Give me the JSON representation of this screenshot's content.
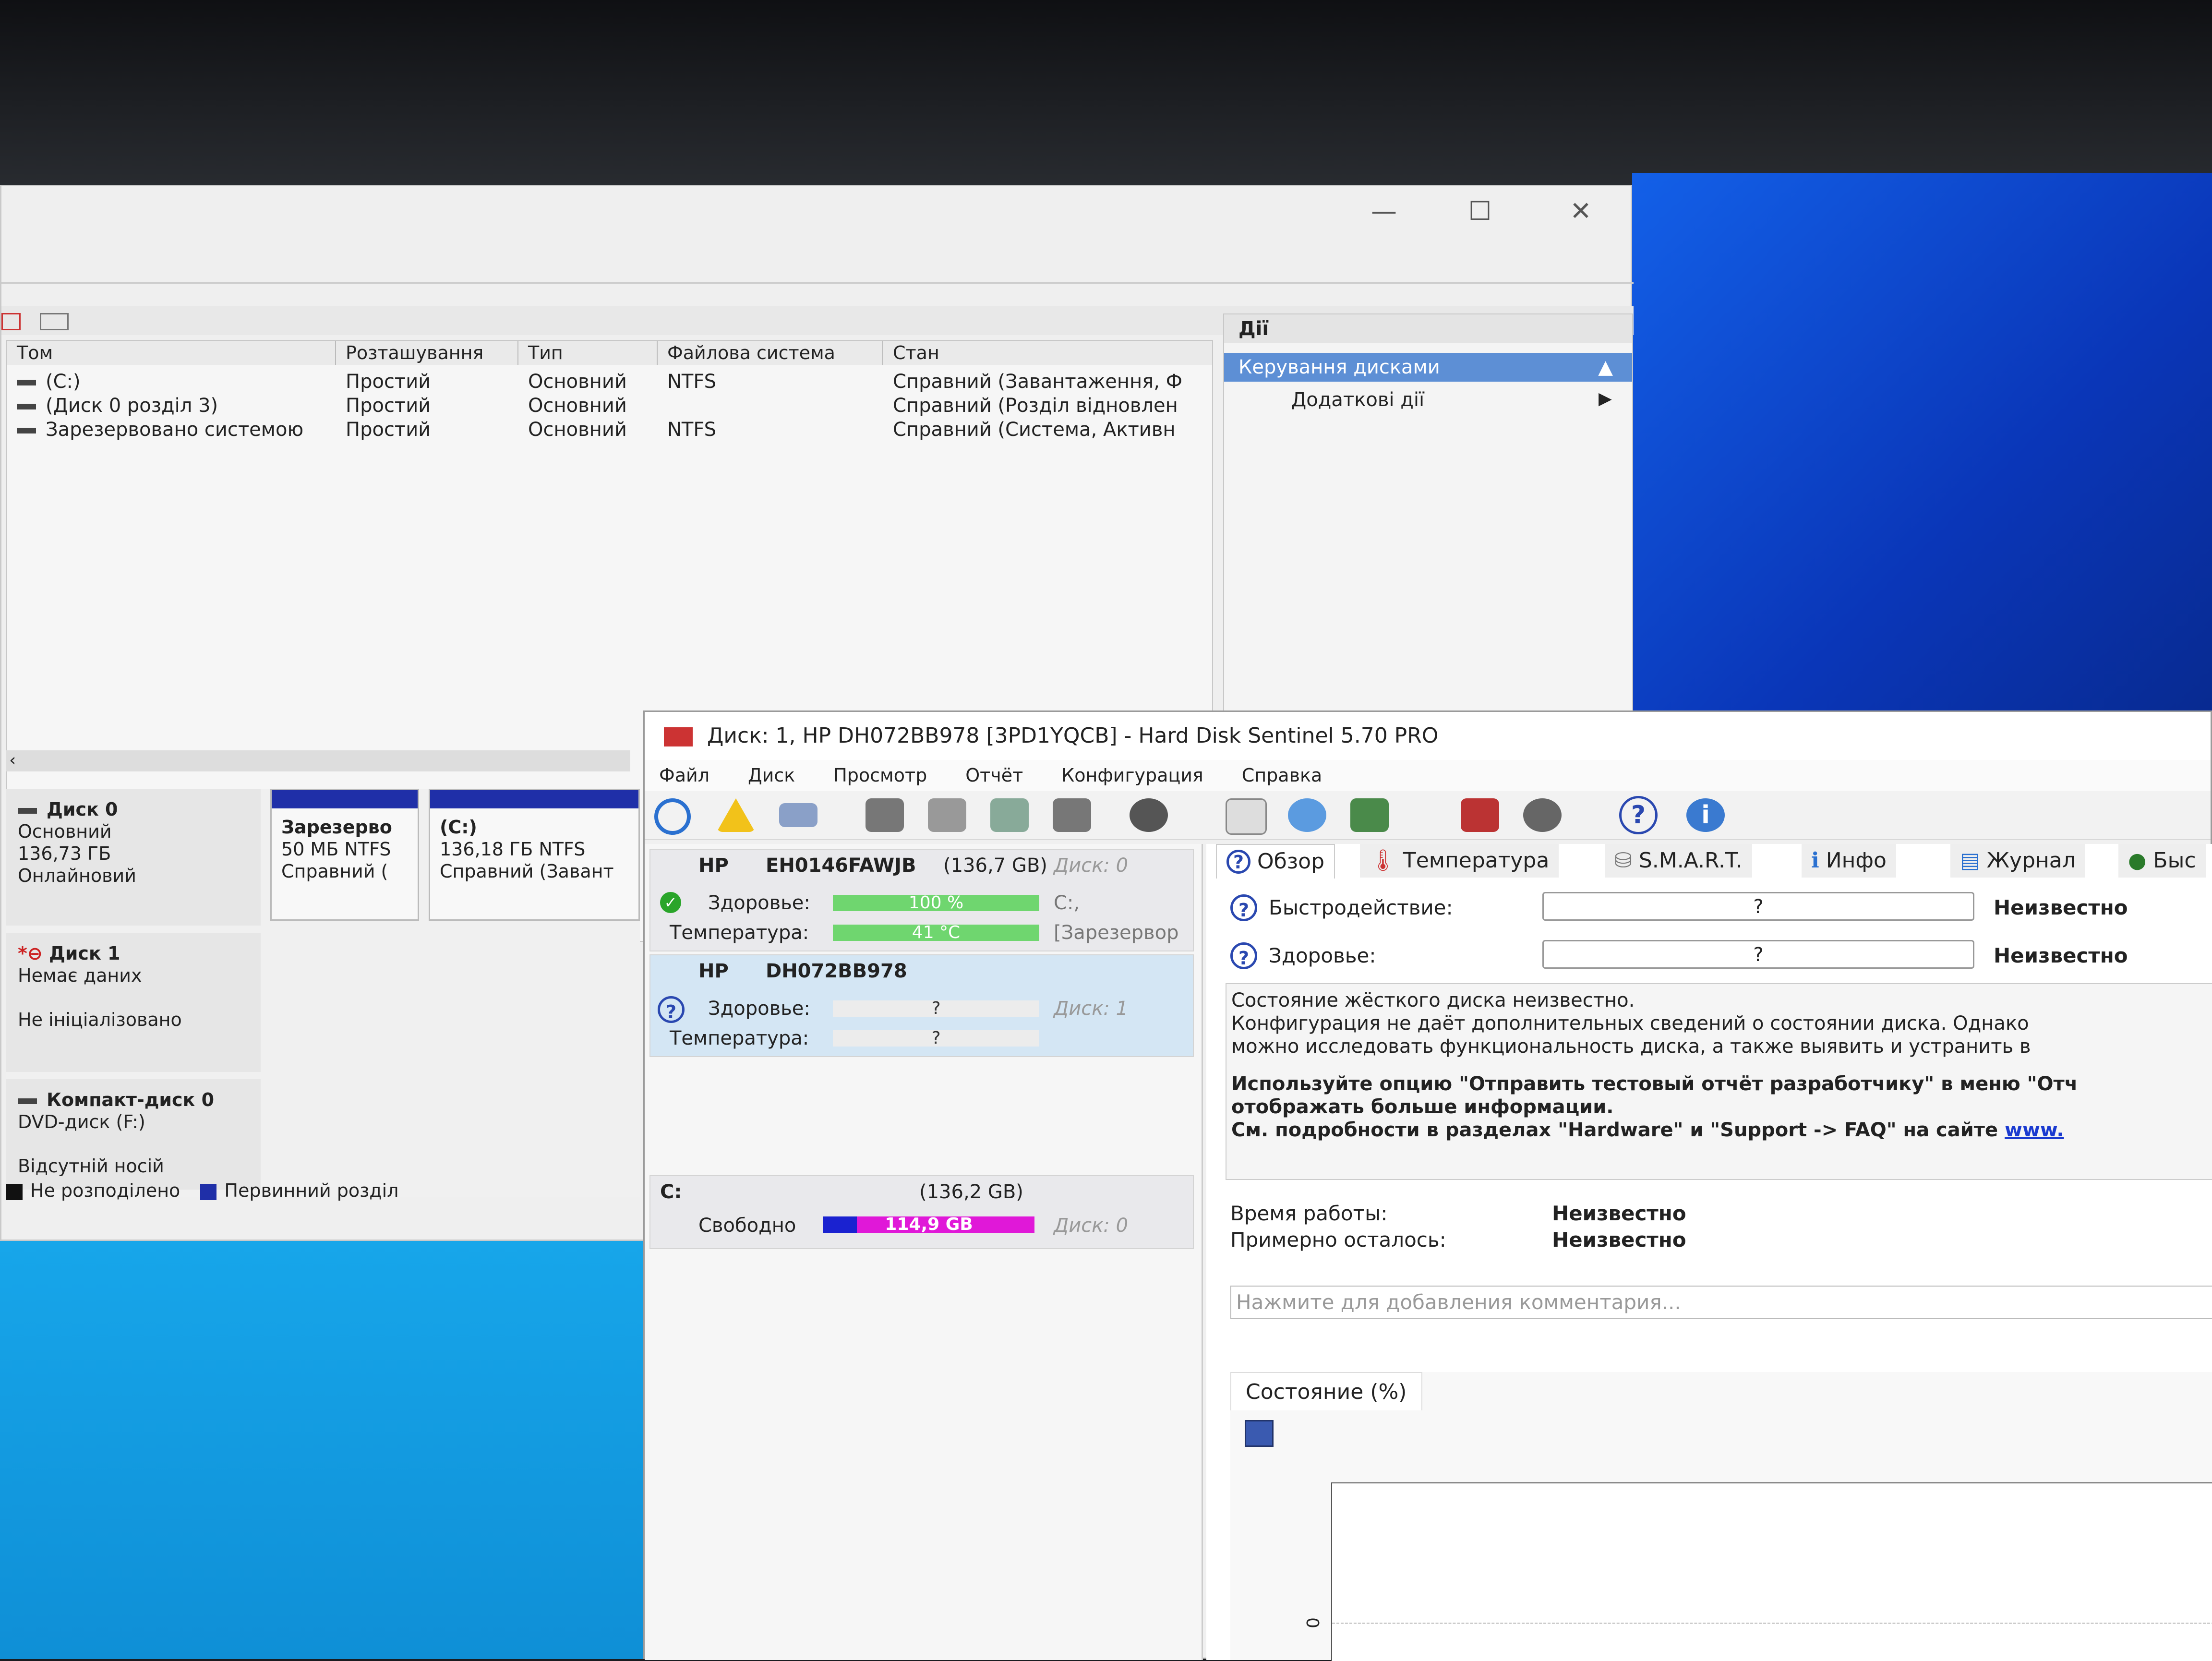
{
  "disk_management": {
    "columns": [
      "Том",
      "Розташування",
      "Тип",
      "Файлова система",
      "Стан"
    ],
    "volumes": [
      {
        "name": "(C:)",
        "layout": "Простий",
        "type": "Основний",
        "fs": "NTFS",
        "status": "Справний (Завантаження, Ф"
      },
      {
        "name": "(Диск 0 розділ 3)",
        "layout": "Простий",
        "type": "Основний",
        "fs": "",
        "status": "Справний (Розділ відновлен"
      },
      {
        "name": "Зарезервовано системою",
        "layout": "Простий",
        "type": "Основний",
        "fs": "NTFS",
        "status": "Справний (Система, Активн"
      }
    ],
    "actions": {
      "header": "Дії",
      "selected": "Керування дисками",
      "sub": "Додаткові дії"
    },
    "disks": [
      {
        "name": "Диск 0",
        "line1": "Основний",
        "line2": "136,73 ГБ",
        "line3": "Онлайновий"
      },
      {
        "name": "Диск 1",
        "line1": "Немає даних",
        "line2": "",
        "line3": "Не ініціалізовано"
      },
      {
        "name": "Компакт-диск 0",
        "line1": "DVD-диск (F:)",
        "line2": "",
        "line3": "Відсутній носій"
      }
    ],
    "partitions": [
      {
        "title": "Зарезерво",
        "size": "50 МБ NTFS",
        "status": "Справний ("
      },
      {
        "title": "(C:)",
        "size": "136,18 ГБ NTFS",
        "status": "Справний (Завант"
      }
    ],
    "legend": {
      "unallocated": "Не розподілено",
      "primary": "Первинний розділ"
    }
  },
  "hds": {
    "title": "Диск: 1, HP      DH072BB978 [3PD1YQCB]  -  Hard Disk Sentinel 5.70 PRO",
    "menu": [
      "Файл",
      "Диск",
      "Просмотр",
      "Отчёт",
      "Конфигурация",
      "Справка"
    ],
    "disk0": {
      "vendor": "HP",
      "model": "EH0146FAWJB",
      "size": "(136,7 GB)",
      "disk_label": "Диск: 0",
      "health_label": "Здоровье:",
      "health_value": "100 %",
      "health_pct": 100,
      "temp_label": "Температура:",
      "temp_value": "41 °C",
      "vol1": "C:,",
      "vol2": "[Зарезервор"
    },
    "disk1": {
      "vendor": "HP",
      "model": "DH072BB978",
      "health_label": "Здоровье:",
      "health_value": "?",
      "disk_label": "Диск: 1",
      "temp_label": "Температура:",
      "temp_value": "?"
    },
    "volume": {
      "letter": "C:",
      "size": "(136,2 GB)",
      "free_label": "Свободно",
      "free_value": "114,9 GB",
      "disk_label": "Диск: 0",
      "free_pct": 84
    },
    "tabs": [
      "Обзор",
      "Температура",
      "S.M.A.R.T.",
      "Инфо",
      "Журнал",
      "Быс"
    ],
    "perf_label": "Быстродействие:",
    "perf_value": "?",
    "perf_status": "Неизвестно",
    "health_label": "Здоровье:",
    "health_value": "?",
    "health_status": "Неизвестно",
    "desc": {
      "l1": "Состояние жёсткого диска неизвестно.",
      "l2": "Конфигурация не даёт дополнительных сведений о состоянии диска. Однако",
      "l3": "можно исследовать функциональность диска, а также выявить и устранить в",
      "l4": "Используйте опцию \"Отправить тестовый отчёт разработчику\" в меню \"Отч",
      "l5": "отображать больше информации.",
      "l6": "См. подробности в разделах \"Hardware\" и \"Support -> FAQ\" на сайте ",
      "link": "www."
    },
    "uptime_label": "Время работы:",
    "uptime_value": "Неизвестно",
    "remaining_label": "Примерно осталось:",
    "remaining_value": "Неизвестно",
    "comment_placeholder": "Нажмите для добавления комментария...",
    "chart_tab": "Состояние (%)",
    "chart_y_tick": "0"
  },
  "colors": {
    "accent_blue": "#1f2fa8",
    "health_green": "#6fd66f",
    "free_magenta": "#e018d8"
  }
}
